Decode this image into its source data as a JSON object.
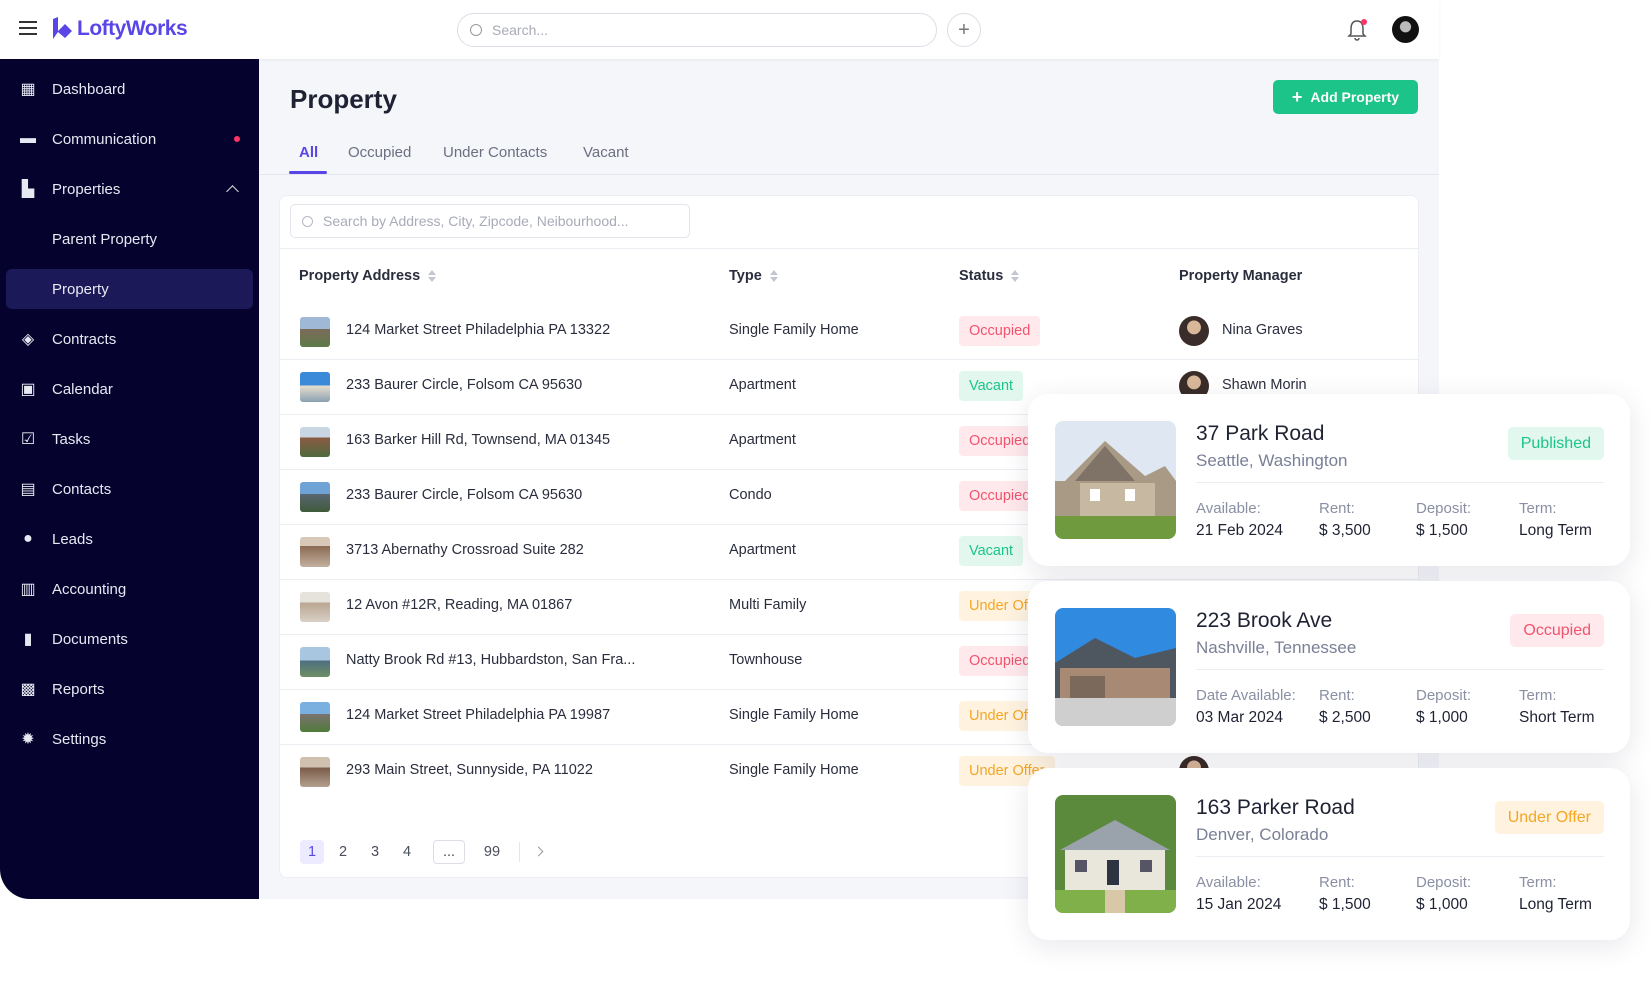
{
  "app": {
    "brand": "LoftyWorks",
    "search_placeholder": "Search...",
    "brand_color": "#5a46e6"
  },
  "sidebar": {
    "items": [
      {
        "label": "Dashboard",
        "icon": "dashboard-icon"
      },
      {
        "label": "Communication",
        "icon": "chat-icon",
        "badge_dot": true
      },
      {
        "label": "Properties",
        "icon": "building-icon",
        "expanded": true
      },
      {
        "label": "Parent Property",
        "sub": true
      },
      {
        "label": "Property",
        "sub": true,
        "active": true
      },
      {
        "label": "Contracts",
        "icon": "contract-icon"
      },
      {
        "label": "Calendar",
        "icon": "calendar-icon"
      },
      {
        "label": "Tasks",
        "icon": "tasks-icon"
      },
      {
        "label": "Contacts",
        "icon": "contacts-icon"
      },
      {
        "label": "Leads",
        "icon": "leads-icon"
      },
      {
        "label": "Accounting",
        "icon": "bank-icon"
      },
      {
        "label": "Documents",
        "icon": "document-icon"
      },
      {
        "label": "Reports",
        "icon": "chart-icon"
      },
      {
        "label": "Settings",
        "icon": "gear-icon"
      }
    ]
  },
  "page": {
    "title": "Property",
    "add_button": "Add Property",
    "tabs": [
      "All",
      "Occupied",
      "Under Contacts",
      "Vacant"
    ],
    "active_tab": "All",
    "search_placeholder": "Search by Address, City, Zipcode, Neibourhood..."
  },
  "table": {
    "headers": [
      "Property Address",
      "Type",
      "Status",
      "Property Manager"
    ],
    "rows": [
      {
        "address": "124 Market Street Philadelphia PA 13322",
        "type": "Single Family Home",
        "status": "Occupied",
        "manager": "Nina Graves"
      },
      {
        "address": "233 Baurer Circle, Folsom CA 95630",
        "type": "Apartment",
        "status": "Vacant",
        "manager": "Shawn Morin"
      },
      {
        "address": "163 Barker Hill Rd, Townsend, MA 01345",
        "type": "Apartment",
        "status": "Occupied"
      },
      {
        "address": "233 Baurer Circle, Folsom CA 95630",
        "type": "Condo",
        "status": "Occupied"
      },
      {
        "address": "3713 Abernathy Crossroad Suite 282",
        "type": "Apartment",
        "status": "Vacant"
      },
      {
        "address": "12 Avon #12R, Reading, MA 01867",
        "type": "Multi Family",
        "status": "Under Offer"
      },
      {
        "address": "Natty Brook Rd #13, Hubbardston, San Fra...",
        "type": "Townhouse",
        "status": "Occupied"
      },
      {
        "address": "124 Market Street Philadelphia PA 19987",
        "type": "Single Family Home",
        "status": "Under Offer"
      },
      {
        "address": "293 Main Street, Sunnyside, PA 11022",
        "type": "Single Family Home",
        "status": "Under Offer"
      }
    ]
  },
  "pagination": {
    "pages": [
      "1",
      "2",
      "3",
      "4",
      "...",
      "99"
    ],
    "current": "1"
  },
  "cards": [
    {
      "title": "37 Park Road",
      "location": "Seattle, Washington",
      "status": "Published",
      "fields": [
        {
          "label": "Available:",
          "value": "21 Feb 2024"
        },
        {
          "label": "Rent:",
          "value": "$ 3,500"
        },
        {
          "label": "Deposit:",
          "value": "$ 1,500"
        },
        {
          "label": "Term:",
          "value": "Long Term"
        }
      ]
    },
    {
      "title": "223 Brook Ave",
      "location": "Nashville, Tennessee",
      "status": "Occupied",
      "fields": [
        {
          "label": "Date Available:",
          "value": "03 Mar 2024"
        },
        {
          "label": "Rent:",
          "value": "$ 2,500"
        },
        {
          "label": "Deposit:",
          "value": "$ 1,000"
        },
        {
          "label": "Term:",
          "value": "Short Term"
        }
      ]
    },
    {
      "title": "163 Parker Road",
      "location": "Denver, Colorado",
      "status": "Under Offer",
      "fields": [
        {
          "label": "Available:",
          "value": "15 Jan 2024"
        },
        {
          "label": "Rent:",
          "value": "$ 1,500"
        },
        {
          "label": "Deposit:",
          "value": "$ 1,000"
        },
        {
          "label": "Term:",
          "value": "Long Term"
        }
      ]
    }
  ],
  "colors": {
    "occupied": "#f2546e",
    "vacant": "#1cc48a",
    "under_offer": "#f5a623",
    "sidebar": "#05032e",
    "accent": "#5a46e6"
  }
}
